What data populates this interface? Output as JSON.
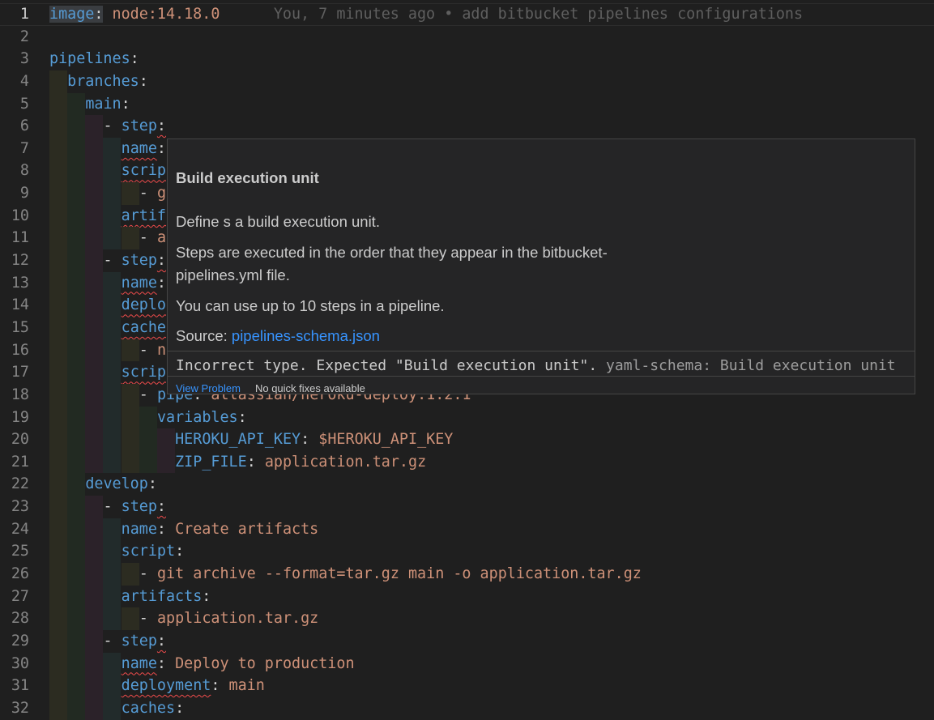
{
  "editor": {
    "current_line": 1,
    "blame": "You, 7 minutes ago • add bitbucket pipelines configurations",
    "lines": [
      {
        "n": 1,
        "indent": 0,
        "tokens": [
          [
            "image",
            "k sel",
            0
          ],
          [
            ":",
            "p sel",
            0
          ],
          [
            " node:14.18.0",
            "s",
            0
          ]
        ]
      },
      {
        "n": 2,
        "indent": 0,
        "tokens": []
      },
      {
        "n": 3,
        "indent": 0,
        "tokens": [
          [
            "pipelines",
            "k",
            0
          ],
          [
            ":",
            "p",
            0
          ]
        ]
      },
      {
        "n": 4,
        "indent": 2,
        "tokens": [
          [
            "branches",
            "k",
            0
          ],
          [
            ":",
            "p",
            0
          ]
        ]
      },
      {
        "n": 5,
        "indent": 4,
        "tokens": [
          [
            "main",
            "k",
            0
          ],
          [
            ":",
            "p",
            0
          ]
        ]
      },
      {
        "n": 6,
        "indent": 6,
        "tokens": [
          [
            "- ",
            "p",
            0
          ],
          [
            "step",
            "k",
            0
          ],
          [
            ":",
            "p",
            1
          ]
        ]
      },
      {
        "n": 7,
        "indent": 8,
        "tokens": [
          [
            "name",
            "k",
            1
          ],
          [
            ":",
            "p",
            0
          ]
        ]
      },
      {
        "n": 8,
        "indent": 8,
        "tokens": [
          [
            "scrip",
            "k",
            1
          ]
        ]
      },
      {
        "n": 9,
        "indent": 10,
        "tokens": [
          [
            "- ",
            "p",
            0
          ],
          [
            "g",
            "s",
            0
          ]
        ]
      },
      {
        "n": 10,
        "indent": 8,
        "tokens": [
          [
            "artif",
            "k",
            1
          ]
        ]
      },
      {
        "n": 11,
        "indent": 10,
        "tokens": [
          [
            "- ",
            "p",
            0
          ],
          [
            "a",
            "s",
            0
          ]
        ]
      },
      {
        "n": 12,
        "indent": 6,
        "tokens": [
          [
            "- ",
            "p",
            0
          ],
          [
            "step",
            "k",
            0
          ],
          [
            ":",
            "p",
            1
          ]
        ]
      },
      {
        "n": 13,
        "indent": 8,
        "tokens": [
          [
            "name",
            "k",
            1
          ],
          [
            ":",
            "p",
            0
          ]
        ]
      },
      {
        "n": 14,
        "indent": 8,
        "tokens": [
          [
            "deplo",
            "k",
            1
          ]
        ]
      },
      {
        "n": 15,
        "indent": 8,
        "tokens": [
          [
            "cache",
            "k",
            1
          ]
        ]
      },
      {
        "n": 16,
        "indent": 10,
        "tokens": [
          [
            "- ",
            "p",
            0
          ],
          [
            "n",
            "s",
            0
          ]
        ]
      },
      {
        "n": 17,
        "indent": 8,
        "tokens": [
          [
            "scrip",
            "k",
            1
          ]
        ]
      },
      {
        "n": 18,
        "indent": 10,
        "tokens": [
          [
            "- ",
            "p",
            0
          ],
          [
            "pipe",
            "k",
            0
          ],
          [
            ": ",
            "p",
            0
          ],
          [
            "atlassian/heroku-deploy:1.2.1",
            "s",
            0
          ]
        ]
      },
      {
        "n": 19,
        "indent": 12,
        "tokens": [
          [
            "variables",
            "k",
            0
          ],
          [
            ":",
            "p",
            0
          ]
        ]
      },
      {
        "n": 20,
        "indent": 14,
        "tokens": [
          [
            "HEROKU_API_KEY",
            "k",
            0
          ],
          [
            ": ",
            "p",
            0
          ],
          [
            "$HEROKU_API_KEY",
            "s",
            0
          ]
        ]
      },
      {
        "n": 21,
        "indent": 14,
        "tokens": [
          [
            "ZIP_FILE",
            "k",
            0
          ],
          [
            ": ",
            "p",
            0
          ],
          [
            "application.tar.gz",
            "s",
            0
          ]
        ]
      },
      {
        "n": 22,
        "indent": 4,
        "tokens": [
          [
            "develop",
            "k",
            0
          ],
          [
            ":",
            "p",
            0
          ]
        ]
      },
      {
        "n": 23,
        "indent": 6,
        "tokens": [
          [
            "- ",
            "p",
            0
          ],
          [
            "step",
            "k",
            0
          ],
          [
            ":",
            "p",
            1
          ]
        ]
      },
      {
        "n": 24,
        "indent": 8,
        "tokens": [
          [
            "name",
            "k",
            0
          ],
          [
            ": ",
            "p",
            0
          ],
          [
            "Create artifacts",
            "s",
            0
          ]
        ]
      },
      {
        "n": 25,
        "indent": 8,
        "tokens": [
          [
            "script",
            "k",
            0
          ],
          [
            ":",
            "p",
            0
          ]
        ]
      },
      {
        "n": 26,
        "indent": 10,
        "tokens": [
          [
            "- ",
            "p",
            0
          ],
          [
            "git archive --format=tar.gz main -o application.tar.gz",
            "s",
            0
          ]
        ]
      },
      {
        "n": 27,
        "indent": 8,
        "tokens": [
          [
            "artifacts",
            "k",
            0
          ],
          [
            ":",
            "p",
            0
          ]
        ]
      },
      {
        "n": 28,
        "indent": 10,
        "tokens": [
          [
            "- ",
            "p",
            0
          ],
          [
            "application.tar.gz",
            "s",
            0
          ]
        ]
      },
      {
        "n": 29,
        "indent": 6,
        "tokens": [
          [
            "- ",
            "p",
            0
          ],
          [
            "step",
            "k",
            0
          ],
          [
            ":",
            "p",
            1
          ]
        ]
      },
      {
        "n": 30,
        "indent": 8,
        "tokens": [
          [
            "name",
            "k",
            1
          ],
          [
            ": ",
            "p",
            0
          ],
          [
            "Deploy to production",
            "s",
            0
          ]
        ]
      },
      {
        "n": 31,
        "indent": 8,
        "tokens": [
          [
            "deployment",
            "k",
            1
          ],
          [
            ": ",
            "p",
            0
          ],
          [
            "main",
            "s",
            0
          ]
        ]
      },
      {
        "n": 32,
        "indent": 8,
        "tokens": [
          [
            "caches",
            "k",
            0
          ],
          [
            ":",
            "p",
            0
          ]
        ]
      }
    ]
  },
  "hover": {
    "title": "Build execution unit",
    "desc1": "Define s a build execution unit.",
    "desc2": "Steps are executed in the order that they appear in the bitbucket-pipelines.yml file.",
    "desc3": "You can use up to 10 steps in a pipeline.",
    "source_label": "Source: ",
    "source_link": "pipelines-schema.json",
    "diagnostic": "Incorrect type. Expected \"Build execution unit\".",
    "diagnostic_source": "yaml-schema: Build execution unit",
    "view_problem": "View Problem",
    "no_fixes": "No quick fixes available"
  },
  "colors": {
    "key": "#569cd6",
    "string": "#ce9178",
    "error": "#f14c4c",
    "link": "#3794ff",
    "background": "#1f1f1f"
  }
}
